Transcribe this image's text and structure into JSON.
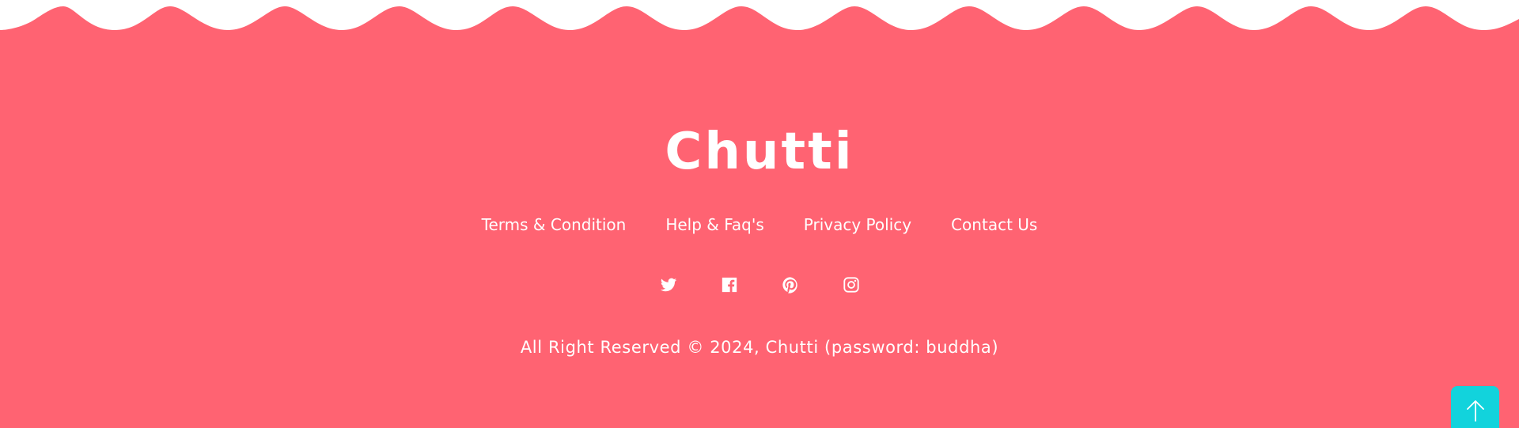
{
  "brand": {
    "logo_text": "Chutti"
  },
  "colors": {
    "background": "#ff6372",
    "text": "#ffffff",
    "wave_top": "#ffffff",
    "back_to_top": "#12d3dc"
  },
  "footer_nav": {
    "items": [
      {
        "label": "Terms & Condition"
      },
      {
        "label": "Help & Faq's"
      },
      {
        "label": "Privacy Policy"
      },
      {
        "label": "Contact Us"
      }
    ]
  },
  "social": {
    "icons": [
      "twitter-icon",
      "facebook-icon",
      "pinterest-icon",
      "instagram-icon"
    ]
  },
  "copyright": {
    "text": "All Right Reserved © 2024, Chutti (password: buddha)"
  },
  "back_to_top": {
    "icon": "arrow-up-icon"
  }
}
